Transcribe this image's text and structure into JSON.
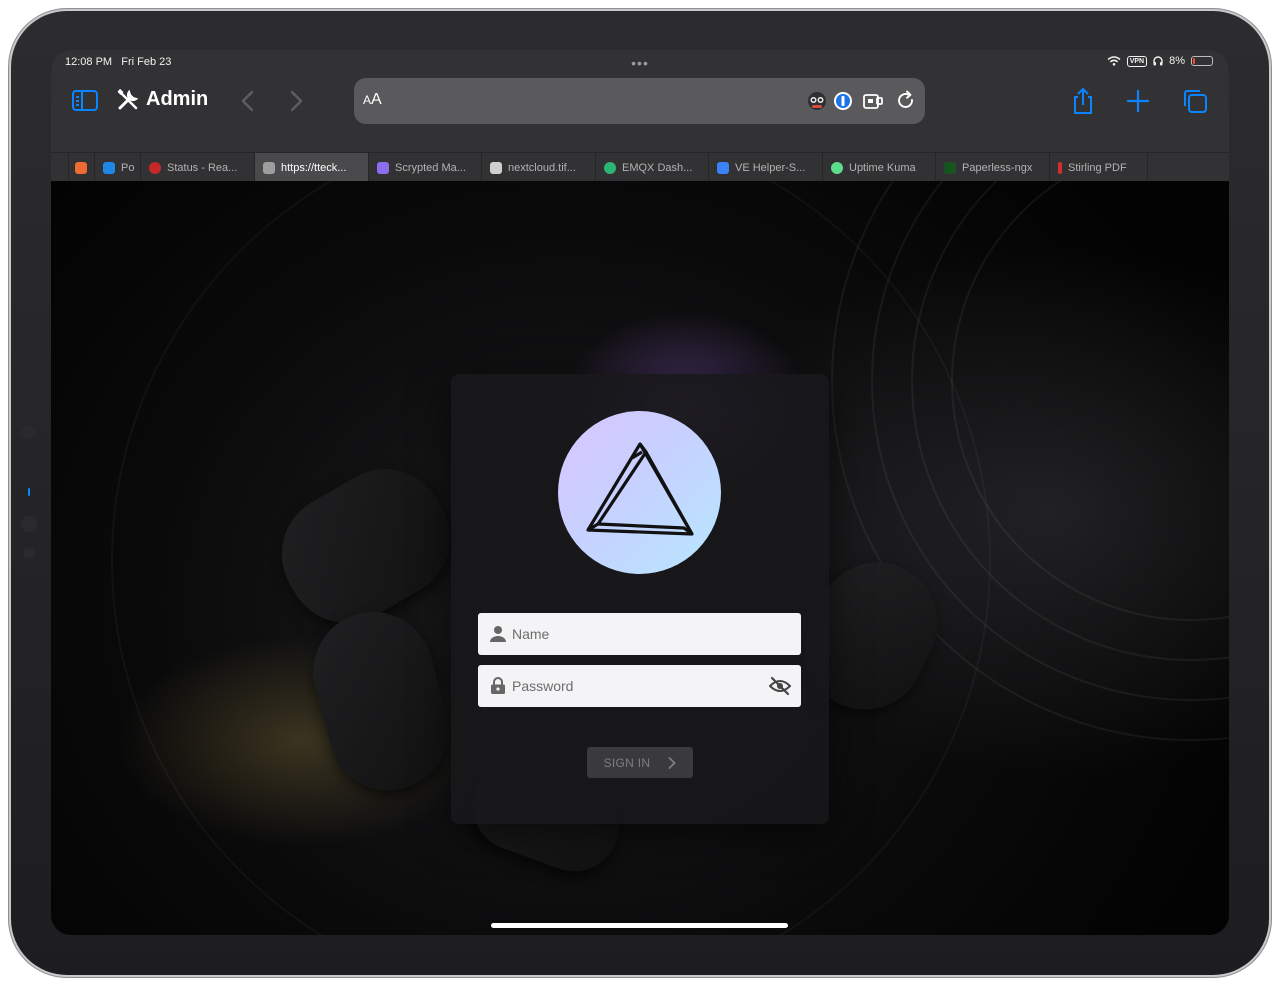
{
  "status_bar": {
    "time": "12:08 PM",
    "date": "Fri Feb 23",
    "vpn_label": "VPN",
    "battery": "8%",
    "battery_level": 0.08
  },
  "toolbar": {
    "title": "Admin",
    "reader_label": "AA",
    "accent": "#0a84ff"
  },
  "tabs": [
    {
      "label": "",
      "favicon": "#f06a35"
    },
    {
      "label": "Po",
      "favicon": "#1e88e5"
    },
    {
      "label": "Status - Rea...",
      "favicon": "#c62828"
    },
    {
      "label": "https://tteck...",
      "favicon": "#9e9e9e",
      "active": true
    },
    {
      "label": "Scrypted Ma...",
      "favicon": "#8e6cf0"
    },
    {
      "label": "nextcloud.tif...",
      "favicon": "#d0d0d0"
    },
    {
      "label": "EMQX Dash...",
      "favicon": "#2bb673"
    },
    {
      "label": "VE Helper-S...",
      "favicon": "#3b82f6"
    },
    {
      "label": "Uptime Kuma",
      "favicon": "#5cdd8b"
    },
    {
      "label": "Paperless-ngx",
      "favicon": "#17541f"
    },
    {
      "label": "Stirling PDF",
      "favicon": "#d32f2f"
    }
  ],
  "login": {
    "name_placeholder": "Name",
    "password_placeholder": "Password",
    "signin_label": "SIGN IN"
  }
}
